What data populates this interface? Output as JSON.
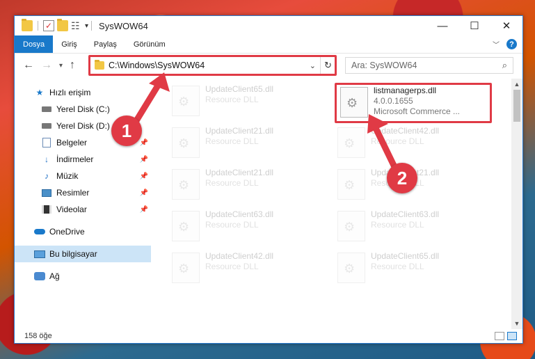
{
  "window": {
    "title": "SysWOW64",
    "min_glyph": "—",
    "max_glyph": "☐",
    "close_glyph": "✕"
  },
  "ribbon": {
    "tabs": [
      "Dosya",
      "Giriş",
      "Paylaş",
      "Görünüm"
    ],
    "help_glyph": "?"
  },
  "address": {
    "path": "C:\\Windows\\SysWOW64"
  },
  "search": {
    "placeholder": "Ara: SysWOW64"
  },
  "sidebar": {
    "items": [
      {
        "label": "Hızlı erişim",
        "icon": "star-icon"
      },
      {
        "label": "Yerel Disk (C:)",
        "icon": "disk-icon"
      },
      {
        "label": "Yerel Disk (D:)",
        "icon": "disk-icon"
      },
      {
        "label": "Belgeler",
        "icon": "documents-icon"
      },
      {
        "label": "İndirmeler",
        "icon": "downloads-icon"
      },
      {
        "label": "Müzik",
        "icon": "music-icon"
      },
      {
        "label": "Resimler",
        "icon": "pictures-icon"
      },
      {
        "label": "Videolar",
        "icon": "videos-icon"
      },
      {
        "label": "OneDrive",
        "icon": "cloud-icon"
      },
      {
        "label": "Bu bilgisayar",
        "icon": "computer-icon"
      },
      {
        "label": "Ağ",
        "icon": "network-icon"
      }
    ]
  },
  "files": [
    {
      "name": "UpdateClient65.dll",
      "sub": "Resource DLL"
    },
    {
      "name": "listmanagerps.dll",
      "sub": "4.0.0.1655",
      "sub2": "Microsoft Commerce ..."
    },
    {
      "name": "UpdateClient21.dll",
      "sub": "Resource DLL"
    },
    {
      "name": "UpdateClient42.dll",
      "sub": "Resource DLL"
    },
    {
      "name": "UpdateClient21.dll",
      "sub": "Resource DLL"
    },
    {
      "name": "UpdateClient21.dll",
      "sub": "Resource DLL"
    },
    {
      "name": "UpdateClient63.dll",
      "sub": "Resource DLL"
    },
    {
      "name": "UpdateClient63.dll",
      "sub": "Resource DLL"
    },
    {
      "name": "UpdateClient42.dll",
      "sub": "Resource DLL"
    },
    {
      "name": "UpdateClient65.dll",
      "sub": "Resource DLL"
    }
  ],
  "status": {
    "count": "158 öğe"
  },
  "annotations": {
    "step1": "1",
    "step2": "2",
    "color": "#e03a45"
  }
}
